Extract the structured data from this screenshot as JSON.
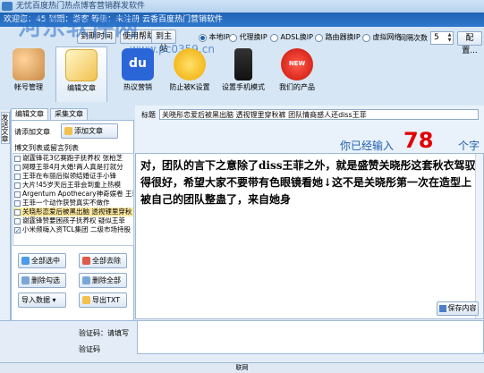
{
  "window": {
    "title": "无忧百度热门热点博客营销群发软件"
  },
  "infobar": {
    "text": "欢迎您：45  到期：游客  等级：未注册  云香百度热门营销软件"
  },
  "watermark": {
    "big": "河东软件网",
    "url": "www.pc0359.cn"
  },
  "toolbar": {
    "login": "到期时间",
    "help": "使用帮助",
    "home": "到主站",
    "mode_local": "本地IP",
    "mode_proxy": "代理换IP",
    "mode_adsl": "ADSL换IP",
    "mode_route": "路由器换IP",
    "mode_vpn": "虚拟网络",
    "interval_label": "间隔次数",
    "interval_value": "5",
    "config": "配置..."
  },
  "nav": [
    {
      "label": "帐号管理"
    },
    {
      "label": "编辑文章"
    },
    {
      "label": "热议营销"
    },
    {
      "label": "防止被K设置"
    },
    {
      "label": "设置手机模式"
    },
    {
      "label": "我们的产品"
    }
  ],
  "left": {
    "vertical_tab": "发送文章",
    "tab_edit": "编辑文章",
    "tab_collect": "采集文章",
    "add_label": "请添加文章",
    "add_button": "添加文章",
    "list_header": "博文列表或留言列表",
    "articles": [
      "谢霆锋花3亿赛跑子抚养权 张柏芝",
      "网曝王菲4月大婚!两人真是打就分",
      "王菲在布丽后拟领结婚证手小锋",
      "大片!45岁天后王菲会到重上热模",
      "Argentum Apothecary神奇娱卷 王菲",
      "王菲一个动作获赞真实不做作",
      "关晓彤恋爱后被黑出脑 透视锂里穿秋",
      "谢霆锋赞要困孩子抚养权 疑似王菲",
      "小米频嗨入资TCL集团 二级市场持股"
    ],
    "btn_select_all": "全部选中",
    "btn_remove_all": "全部去除",
    "btn_delete_checked": "删除勾选",
    "btn_delete_all": "删除全部",
    "btn_import": "导入数据",
    "btn_export": "导出TXT"
  },
  "editor": {
    "title_label": "标题",
    "title_value": "关晓彤恋爱后被黑出脑 透视锂里穿秋裤 团队情商感人还diss王菲",
    "counter_prefix": "你已经输入",
    "counter_value": "78",
    "counter_suffix": "个字",
    "body": "对，团队的言下之意除了diss王菲之外，就是盛赞关晓彤这套秋衣驾驭得很好，希望大家不要带有色眼镜看她↓这不是关晓彤第一次在造型上被自己的团队整蛊了，来自她身",
    "save_button": "保存内容"
  },
  "captcha": {
    "label1": "验证码：请填写",
    "label2": "验证码"
  },
  "status": {
    "text": "联网"
  }
}
